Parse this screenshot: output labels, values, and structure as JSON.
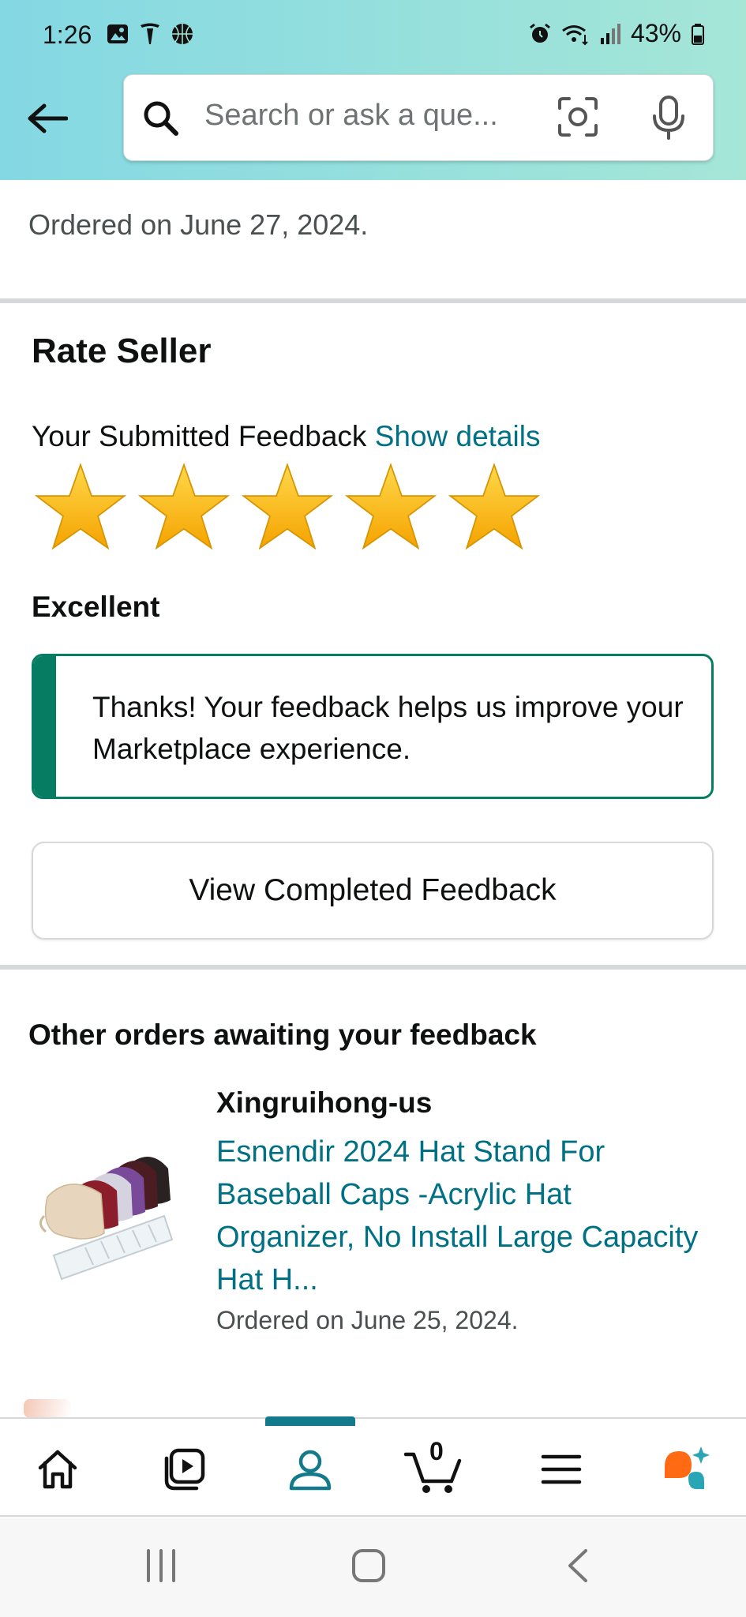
{
  "status_bar": {
    "time": "1:26",
    "battery": "43%",
    "left_icons": [
      "image-icon",
      "tesla-icon",
      "basketball-icon"
    ],
    "right_icons": [
      "alarm-icon",
      "wifi-icon",
      "signal-icon",
      "battery-icon"
    ]
  },
  "search": {
    "placeholder": "Search or ask a que..."
  },
  "order": {
    "ordered_on": "Ordered on June 27, 2024."
  },
  "rate_seller": {
    "title": "Rate Seller",
    "submitted_label": "Your Submitted Feedback",
    "show_details": "Show details",
    "rating": 5,
    "rating_max": 5,
    "rating_label": "Excellent",
    "thanks_message": "Thanks! Your feedback helps us improve your Marketplace experience.",
    "view_button": "View Completed Feedback"
  },
  "other_orders": {
    "title": "Other orders awaiting your feedback",
    "items": [
      {
        "seller": "Xingruihong-us",
        "product_title": "Esnendir 2024 Hat Stand For Baseball Caps -Acrylic Hat Organizer, No Install Large Capacity Hat H...",
        "ordered_on": "Ordered on June 25, 2024."
      }
    ]
  },
  "bottom_nav": {
    "items": [
      "home-icon",
      "video-icon",
      "account-icon",
      "cart-icon",
      "menu-icon",
      "rufus-icon"
    ],
    "cart_count": "0",
    "active": "account-icon"
  },
  "colors": {
    "link": "#007185",
    "success_green": "#067d62",
    "star": "#ffb400",
    "active_nav": "#127a8a",
    "ai_orange": "#ff6a13",
    "ai_teal": "#29a5b5"
  }
}
